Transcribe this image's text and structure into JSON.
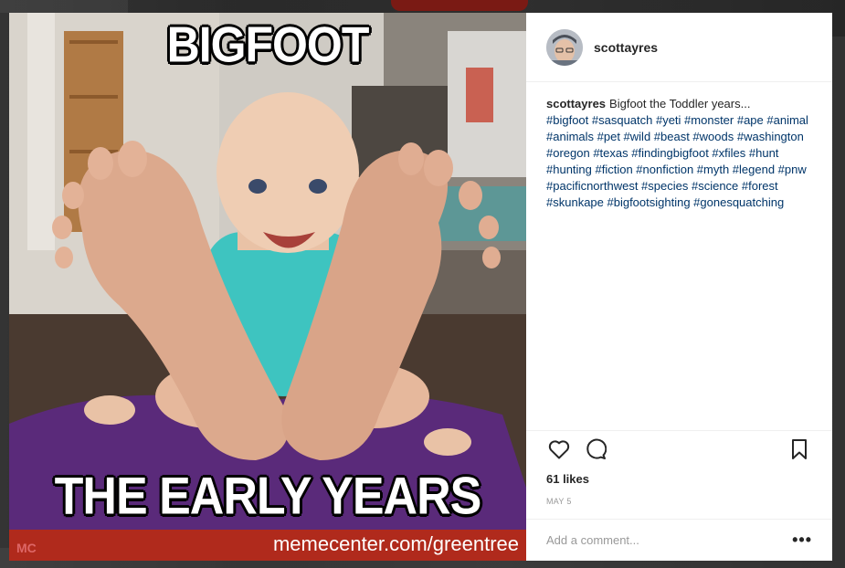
{
  "post": {
    "username": "scottayres",
    "caption_user": "scottayres",
    "caption_text": "Bigfoot the Toddler years...",
    "hashtags": "#bigfoot #sasquatch #yeti #monster #ape #animal #animals #pet #wild #beast #woods #washington #oregon #texas #findingbigfoot #xfiles #hunt #hunting #fiction #nonfiction #myth #legend #pnw #pacificnorthwest #species #science #forest #skunkape #bigfootsighting #gonesquatching",
    "likes": "61 likes",
    "date": "MAY 5",
    "comment_placeholder": "Add a comment...",
    "more_label": "•••"
  },
  "meme": {
    "top_text": "BIGFOOT",
    "bottom_text": "THE EARLY YEARS",
    "watermark_url": "memecenter.com/greentree",
    "watermark_logo": "MC"
  },
  "icons": {
    "like": "heart-icon",
    "comment": "comment-bubble-icon",
    "save": "bookmark-icon",
    "more": "more-options-icon"
  },
  "colors": {
    "hashtag": "#003569",
    "text": "#262626",
    "muted": "#999999",
    "watermark_bar": "#b02a1c",
    "shirt": "#3ec4c0",
    "blanket": "#5a2a7a"
  }
}
